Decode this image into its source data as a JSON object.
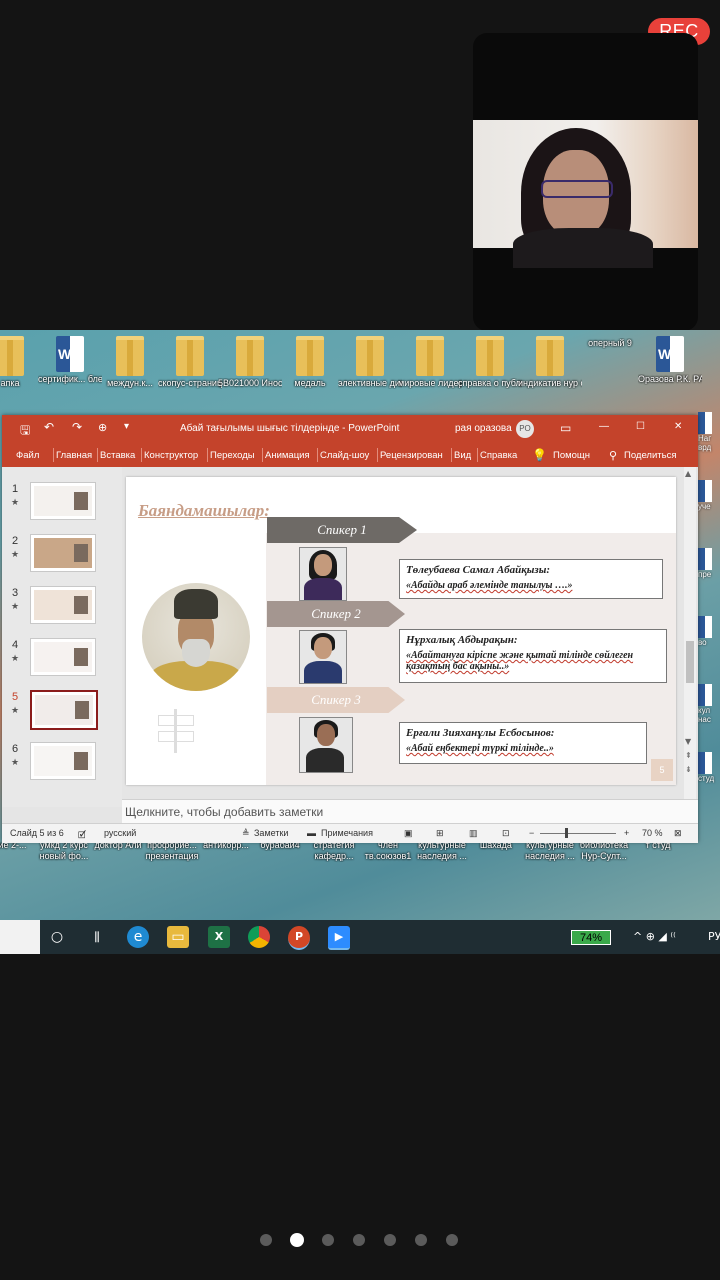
{
  "recording": {
    "label": "REC",
    "color": "#e8413a"
  },
  "desktop": {
    "top_icons": [
      {
        "label": "апка",
        "type": "folder"
      },
      {
        "label": "сертифик... блет",
        "type": "word"
      },
      {
        "label": "междун.к...",
        "type": "folder"
      },
      {
        "label": "скопус-страницы",
        "type": "folder"
      },
      {
        "label": "5В021000 Иностран...",
        "type": "folder"
      },
      {
        "label": "медаль",
        "type": "folder"
      },
      {
        "label": "элективные дисциплины",
        "type": "folder"
      },
      {
        "label": "мировые лидеры, ...",
        "type": "folder"
      },
      {
        "label": "справка о публикации",
        "type": "folder"
      },
      {
        "label": "индикатив нур султан",
        "type": "folder"
      },
      {
        "label": "оперный 9",
        "type": "photo"
      },
      {
        "label": "Оразова Р.К. РАСПИСА...",
        "type": "word"
      }
    ],
    "bottom_icons": [
      {
        "label": "ние 2-..."
      },
      {
        "label": "умкд 2 курс новый фо..."
      },
      {
        "label": "доктор Али"
      },
      {
        "label": "профорие... презентация"
      },
      {
        "label": "антикорр..."
      },
      {
        "label": "бурабай4"
      },
      {
        "label": "стратегия кафедр..."
      },
      {
        "label": "член тв.союзов1"
      },
      {
        "label": "культурные наследия ..."
      },
      {
        "label": "шахада"
      },
      {
        "label": "культурные наследия ..."
      },
      {
        "label": "библиотека Нур-Султ..."
      },
      {
        "label": "т студ"
      }
    ],
    "right_strip": [
      "Наг врд",
      "уче",
      "пре",
      "во",
      "кул нас",
      "студ"
    ]
  },
  "powerpoint": {
    "title": "Абай тағылымы шығыс тілдерінде  -  PowerPoint",
    "user_name": "рая оразова",
    "user_initials": "РО",
    "window_controls": {
      "ribbon_display": "▭",
      "minimize": "—",
      "maximize": "☐",
      "close": "✕"
    },
    "ribbon_tabs": [
      "Файл",
      "Главная",
      "Вставка",
      "Конструктор",
      "Переходы",
      "Анимация",
      "Слайд-шоу",
      "Рецензирован",
      "Вид",
      "Справка"
    ],
    "help_label": "Помощн",
    "share_label": "Поделиться",
    "thumbnails": [
      "1",
      "2",
      "3",
      "4",
      "5",
      "6"
    ],
    "selected_thumbnail": 5,
    "slide": {
      "heading": "Баяндамашылар:",
      "speakers": [
        {
          "tag": "Спикер 1",
          "name": "Төлеубаева Самал Абайқызы:",
          "topic": "«Абайды араб әлемінде танылуы ….»"
        },
        {
          "tag": "Спикер 2",
          "name": "Нұрхалық Абдырақын:",
          "topic": "«Абайтануға кіріспе және қытай тілінде сөйлеген қазақтың бас ақыны..»"
        },
        {
          "tag": "Спикер 3",
          "name": "Ерғали Зияханұлы Есбосынов:",
          "topic": "«Абай еңбектері түркі тілінде..»"
        }
      ],
      "page_number": "5"
    },
    "notes_placeholder": "Щелкните, чтобы добавить заметки",
    "status": {
      "slide_info": "Слайд 5 из 6",
      "language": "русский",
      "notes_label": "Заметки",
      "comments_label": "Примечания",
      "zoom": "70 %"
    },
    "accent_color": "#c4432b"
  },
  "taskbar": {
    "battery": "74%",
    "sys_icons": "^ ⊕ ◢ ⁽⁽",
    "lang": "РУ"
  },
  "pager": {
    "count": 7,
    "active_index": 1
  }
}
